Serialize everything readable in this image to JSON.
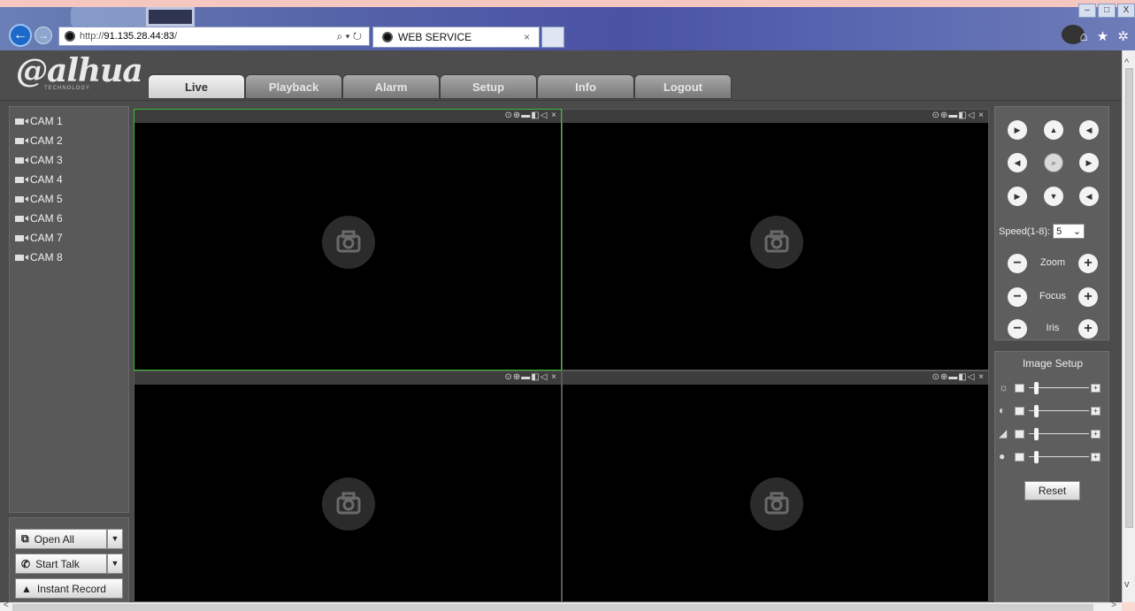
{
  "browser": {
    "url_protocol": "http://",
    "url_host": "91.135.28.44:83",
    "url_rest": "/",
    "address_controls": "⌕ ▾ ↻",
    "tab_title": "WEB SERVICE",
    "tab_close": "×",
    "window_controls": [
      "–",
      "□",
      "X"
    ],
    "right_icons": "⌂ ★ ✲"
  },
  "header": {
    "logo": "alhua",
    "logo_prefix": "@",
    "logo_sub": "TECHNOLOGY",
    "menu": [
      "Live",
      "Playback",
      "Alarm",
      "Setup",
      "Info",
      "Logout"
    ],
    "active_menu": "Live"
  },
  "cameras": [
    "CAM 1",
    "CAM 2",
    "CAM 3",
    "CAM 4",
    "CAM 5",
    "CAM 6",
    "CAM 7",
    "CAM 8"
  ],
  "left_actions": {
    "open_all": "Open All",
    "start_talk": "Start Talk",
    "instant_record": "Instant Record"
  },
  "video": {
    "toolbar_icons": "⊙⊕▬◧◁ ×"
  },
  "ptz": {
    "speed_label": "Speed(1-8):",
    "speed_value": "5",
    "zoom_label": "Zoom",
    "focus_label": "Focus",
    "iris_label": "Iris"
  },
  "image_setup": {
    "title": "Image Setup",
    "reset_label": "Reset",
    "icons": [
      "☼",
      "◐",
      "◢",
      "●"
    ]
  }
}
